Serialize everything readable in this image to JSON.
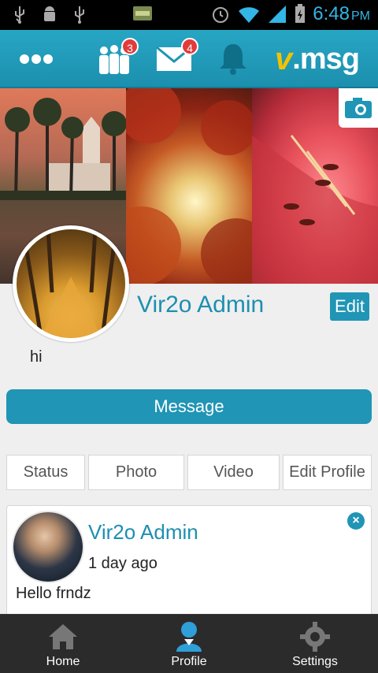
{
  "status_bar": {
    "time": "6:48",
    "ampm": "PM"
  },
  "action_bar": {
    "friends_badge": "3",
    "messages_badge": "4",
    "logo_v": "v",
    "logo_text": ".msg"
  },
  "profile": {
    "name": "Vir2o Admin",
    "edit_label": "Edit",
    "bio": "hi",
    "message_label": "Message"
  },
  "tabs": [
    {
      "label": "Status"
    },
    {
      "label": "Photo"
    },
    {
      "label": "Video"
    },
    {
      "label": "Edit Profile"
    }
  ],
  "post": {
    "author": "Vir2o Admin",
    "time": "1 day ago",
    "text": "Hello frndz"
  },
  "bottom_nav": [
    {
      "label": "Home",
      "icon": "home-icon"
    },
    {
      "label": "Profile",
      "icon": "profile-icon"
    },
    {
      "label": "Settings",
      "icon": "gear-icon"
    }
  ],
  "colors": {
    "accent": "#2095b5",
    "name_text": "#1d8fb0",
    "badge": "#e23b3b",
    "clock": "#33b5e5"
  }
}
